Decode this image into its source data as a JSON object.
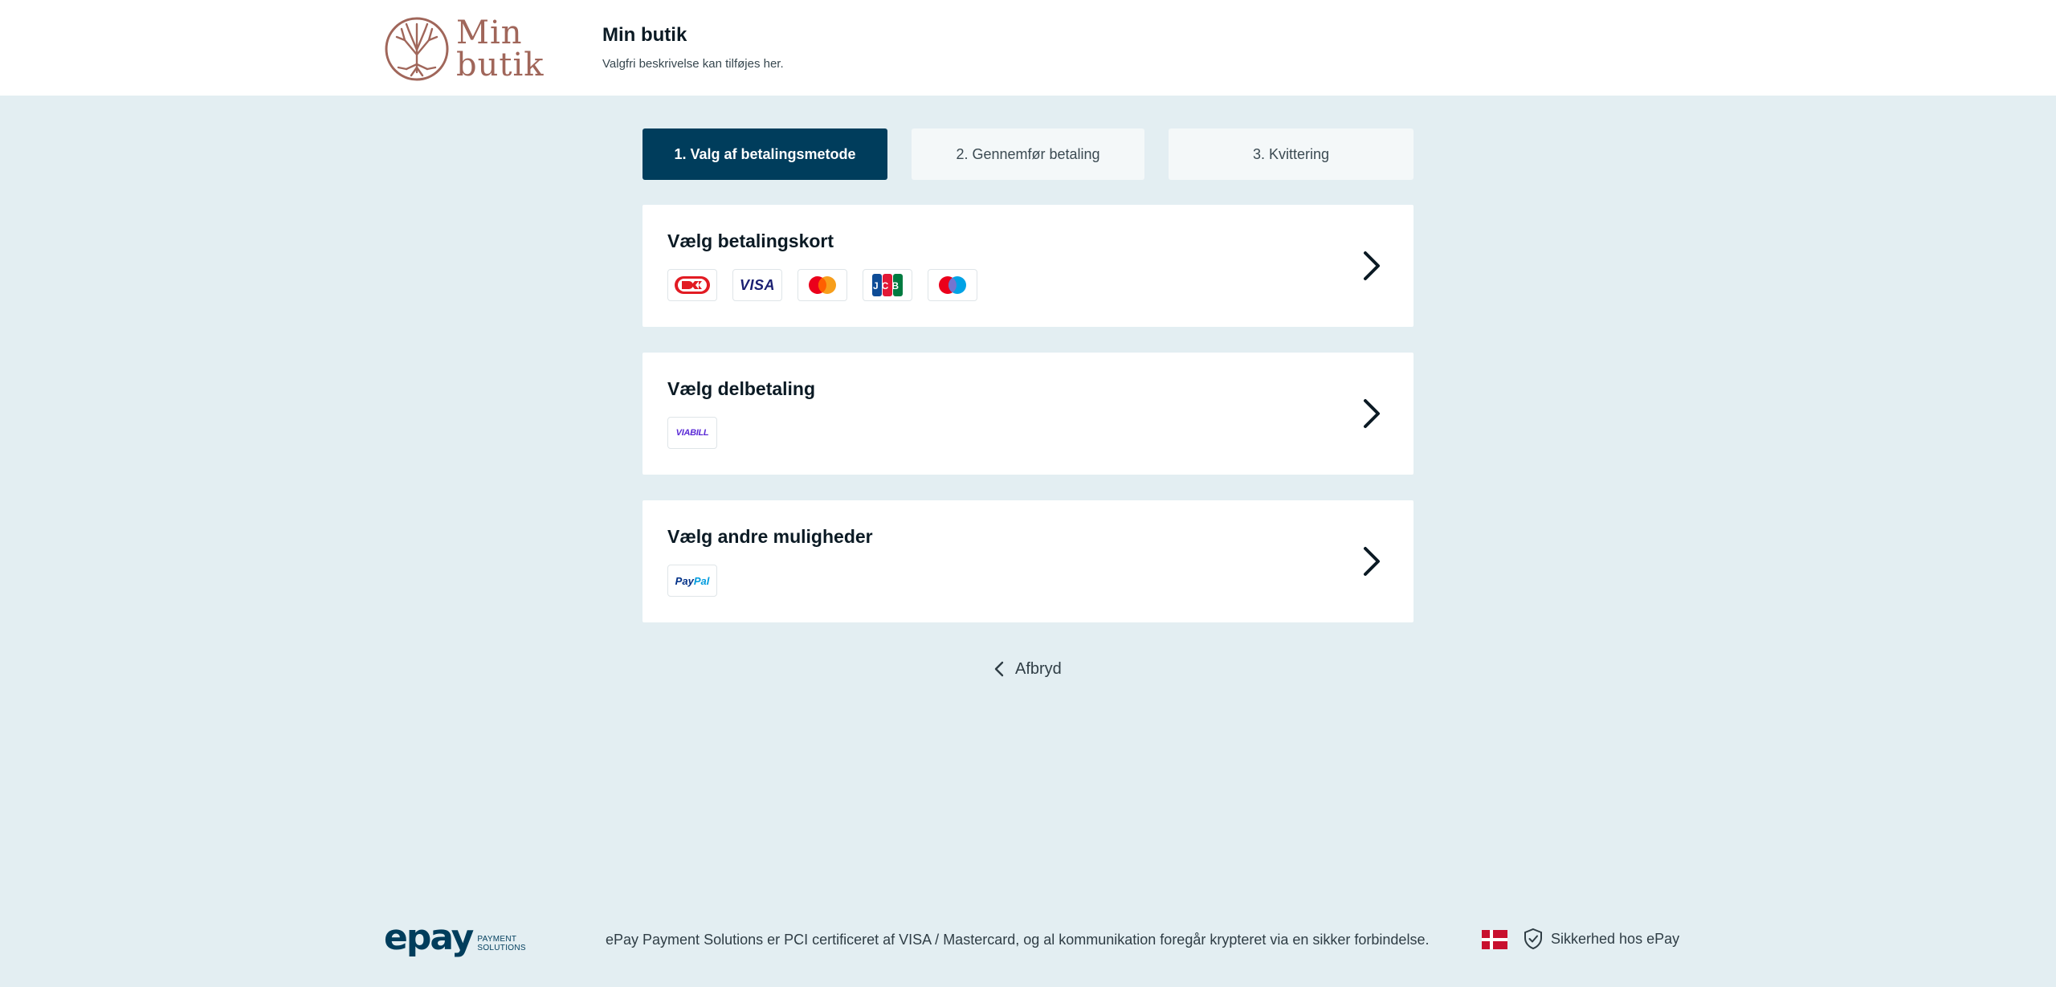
{
  "header": {
    "logo_line1": "Min",
    "logo_line2": "butik",
    "shop_title": "Min butik",
    "shop_description": "Valgfri beskrivelse kan tilføjes her."
  },
  "steps": [
    {
      "label": "1. Valg af betalingsmetode",
      "active": true
    },
    {
      "label": "2. Gennemfør betaling",
      "active": false
    },
    {
      "label": "3. Kvittering",
      "active": false
    }
  ],
  "cards": [
    {
      "title": "Vælg betalingskort",
      "logos": [
        "dankort-icon",
        "visa-icon",
        "mastercard-icon",
        "jcb-icon",
        "maestro-icon"
      ]
    },
    {
      "title": "Vælg delbetaling",
      "logos": [
        "viabill-icon"
      ]
    },
    {
      "title": "Vælg andre muligheder",
      "logos": [
        "paypal-icon"
      ]
    }
  ],
  "logo_texts": {
    "visa": "VISA",
    "jcb": "JCB",
    "viabill": "VIABILL",
    "paypal_pay": "Pay",
    "paypal_pal": "Pal"
  },
  "cancel_label": "Afbryd",
  "footer": {
    "brand": "epay",
    "brand_sub_1": "PAYMENT",
    "brand_sub_2": "SOLUTIONS",
    "text": "ePay Payment Solutions er PCI certificeret af VISA / Mastercard, og al kommunikation foregår krypteret via en sikker forbindelse.",
    "security_label": "Sikkerhed hos ePay"
  },
  "colors": {
    "background": "#e3eef2",
    "primary": "#003d5c",
    "brand_logo": "#a0665a"
  }
}
